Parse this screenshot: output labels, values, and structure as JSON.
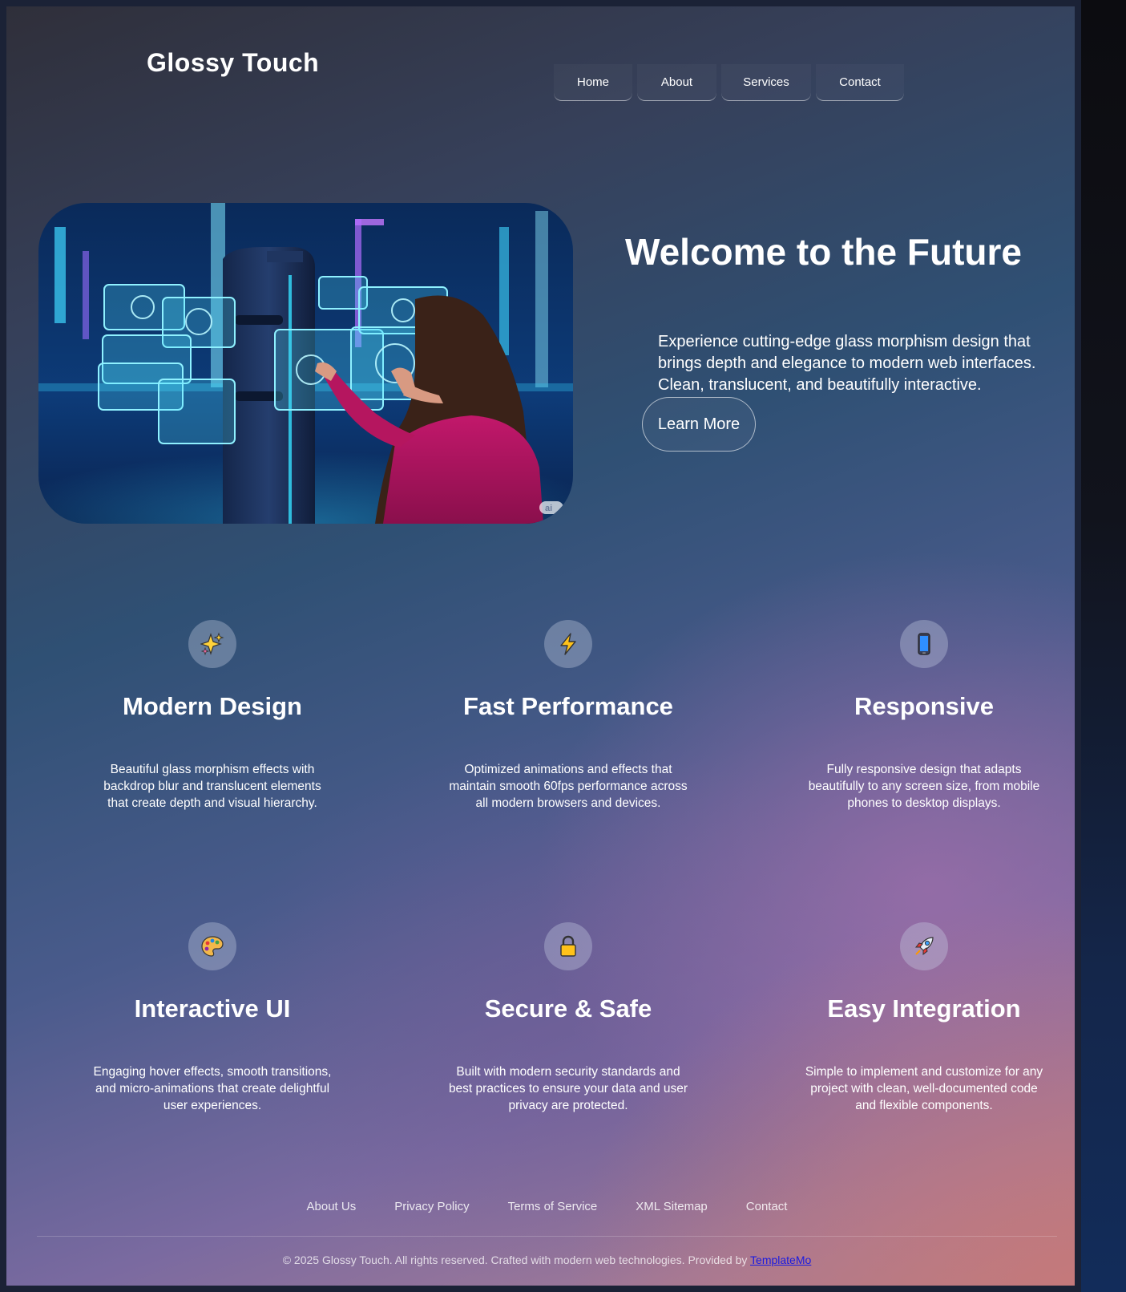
{
  "brand": {
    "logo": "Glossy Touch"
  },
  "nav": {
    "items": [
      {
        "label": "Home"
      },
      {
        "label": "About"
      },
      {
        "label": "Services"
      },
      {
        "label": "Contact"
      }
    ]
  },
  "hero": {
    "title": "Welcome to the Future",
    "text": "Experience cutting-edge glass morphism design that brings depth and elegance to modern web interfaces. Clean, translucent, and beautifully interactive.",
    "button": "Learn More",
    "image_watermark": "ai"
  },
  "features": [
    {
      "icon": "sparkles-icon",
      "title": "Modern Design",
      "desc": "Beautiful glass morphism effects with backdrop blur and translucent elements that create depth and visual hierarchy."
    },
    {
      "icon": "lightning-icon",
      "title": "Fast Performance",
      "desc": "Optimized animations and effects that maintain smooth 60fps performance across all modern browsers and devices."
    },
    {
      "icon": "mobile-phone-icon",
      "title": "Responsive",
      "desc": "Fully responsive design that adapts beautifully to any screen size, from mobile phones to desktop displays."
    },
    {
      "icon": "palette-icon",
      "title": "Interactive UI",
      "desc": "Engaging hover effects, smooth transitions, and micro-animations that create delightful user experiences."
    },
    {
      "icon": "lock-icon",
      "title": "Secure & Safe",
      "desc": "Built with modern security standards and best practices to ensure your data and user privacy are protected."
    },
    {
      "icon": "rocket-icon",
      "title": "Easy Integration",
      "desc": "Simple to implement and customize for any project with clean, well-documented code and flexible components."
    }
  ],
  "footer": {
    "links": [
      {
        "label": "About Us"
      },
      {
        "label": "Privacy Policy"
      },
      {
        "label": "Terms of Service"
      },
      {
        "label": "XML Sitemap"
      },
      {
        "label": "Contact"
      }
    ],
    "copyright": "© 2025 Glossy Touch. All rights reserved. Crafted with modern web technologies. Provided by ",
    "provider_link": "TemplateMo"
  },
  "colors": {
    "text": "#ffffff",
    "link": "#1a1ae0"
  }
}
